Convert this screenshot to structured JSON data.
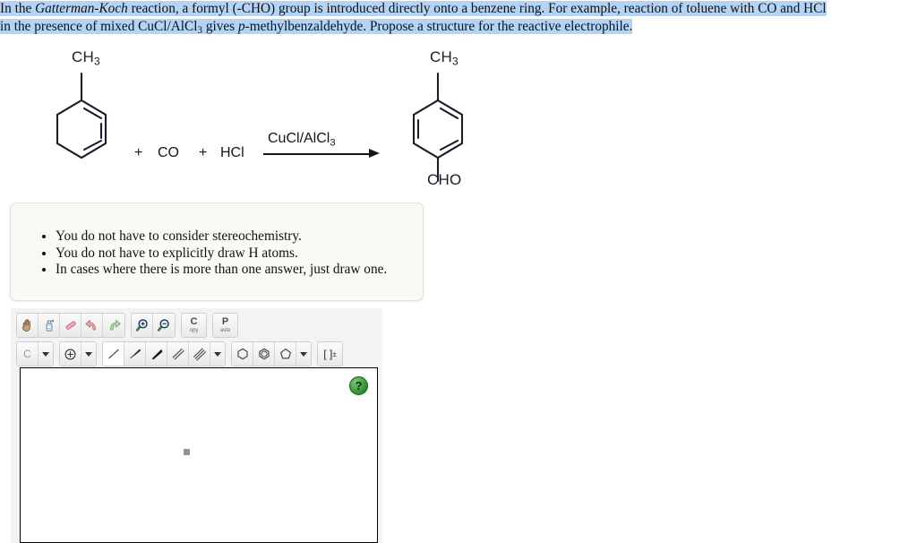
{
  "question": {
    "line1_pre": "In the ",
    "line1_italic": "Gatterman-Koch",
    "line1_post": " reaction, a formyl (-CHO) group is introduced directly onto a benzene ring. For example, reaction of toluene with CO and HCl",
    "line2_pre": "in the presence of mixed CuCl/AlCl",
    "line2_sub": "3",
    "line2_mid": " gives ",
    "line2_italic": "p",
    "line2_post": "-methylbenzaldehyde. Propose a structure for the reactive electrophile.",
    "highlight_color": "#b3d4f7"
  },
  "reaction": {
    "reactant_label": "CH",
    "reactant_label_sub": "3",
    "plus1": "+",
    "co": "CO",
    "plus2": "+",
    "hcl": "HCl",
    "reagent_text": "CuCl/AlCl",
    "reagent_sub": "3",
    "product_top_label": "CH",
    "product_top_sub": "3",
    "product_bottom_label": "CHO"
  },
  "instructions": {
    "items": [
      "You do not have to consider stereochemistry.",
      "You do not have to explicitly draw H atoms.",
      "In cases where there is more than one answer, just draw one."
    ],
    "background_color": "#faf9f4"
  },
  "sketcher": {
    "toolbar_row1": [
      {
        "name": "pan-hand-tool",
        "icon": "hand-icon",
        "label": ""
      },
      {
        "name": "clear-tool",
        "icon": "spray-bottle-icon",
        "label": ""
      },
      {
        "name": "eraser-tool",
        "icon": "eraser-icon",
        "label": ""
      },
      {
        "name": "undo-tool",
        "icon": "undo-arrow-icon",
        "label": ""
      },
      {
        "name": "redo-tool",
        "icon": "redo-arrow-icon",
        "label": ""
      },
      {
        "name": "zoom-in-tool",
        "icon": "magnifier-plus-icon",
        "label": ""
      },
      {
        "name": "zoom-out-tool",
        "icon": "magnifier-minus-icon",
        "label": ""
      }
    ],
    "copy_button": {
      "big": "C",
      "small": "opy"
    },
    "paste_button": {
      "big": "P",
      "small": "aste"
    },
    "element_letter": "C",
    "charge_icon": "circle-plus-icon",
    "bond_tools": [
      {
        "name": "single-bond-tool",
        "selected": true
      },
      {
        "name": "hashed-wedge-bond-tool",
        "selected": false
      },
      {
        "name": "solid-wedge-bond-tool",
        "selected": false
      },
      {
        "name": "double-bond-tool",
        "selected": false
      },
      {
        "name": "triple-bond-tool",
        "selected": false
      }
    ],
    "ring_tools": [
      {
        "name": "cyclohexane-ring-tool",
        "icon": "hexagon-icon"
      },
      {
        "name": "benzene-ring-tool",
        "icon": "benzene-icon"
      },
      {
        "name": "cyclopentane-ring-tool",
        "icon": "pentagon-icon"
      }
    ],
    "bracket_tool_label": "[ ]",
    "bracket_tool_sup": "±",
    "help_label": "?",
    "help_color": "#3b9a3b"
  }
}
